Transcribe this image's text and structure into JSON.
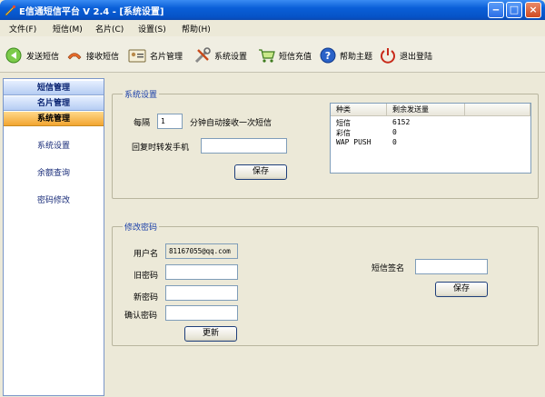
{
  "window": {
    "title": "E信通短信平台 V  2.4 - [系统设置]"
  },
  "menu": [
    "文件(F)",
    "短信(M)",
    "名片(C)",
    "设置(S)",
    "帮助(H)"
  ],
  "toolbar": [
    {
      "label": "发送短信",
      "icon": "send-icon"
    },
    {
      "label": "接收短信",
      "icon": "receive-icon"
    },
    {
      "label": "名片管理",
      "icon": "card-icon"
    },
    {
      "label": "系统设置",
      "icon": "settings-icon"
    },
    {
      "label": "短信充值",
      "icon": "cart-icon"
    },
    {
      "label": "帮助主题",
      "icon": "help-icon"
    },
    {
      "label": "退出登陆",
      "icon": "power-icon"
    }
  ],
  "sidebar": {
    "headers": [
      "短信管理",
      "名片管理",
      "系统管理"
    ],
    "links": [
      "系统设置",
      "余额查询",
      "密码修改"
    ]
  },
  "system_settings": {
    "title": "系统设置",
    "every_label": "每隔",
    "interval_value": "1",
    "interval_suffix": "分钟自动接收一次短信",
    "forward_label": "回复时转发手机",
    "forward_value": "",
    "save_label": "保存"
  },
  "balance": {
    "headers": [
      "种类",
      "剩余发送量"
    ],
    "rows": [
      {
        "type": "短信",
        "count": "6152"
      },
      {
        "type": "彩信",
        "count": "0"
      },
      {
        "type": "WAP PUSH",
        "count": "0"
      }
    ]
  },
  "password": {
    "title": "修改密码",
    "username_label": "用户名",
    "username_value": "81167055@qq.com",
    "old_label": "旧密码",
    "new_label": "新密码",
    "confirm_label": "确认密码",
    "update_label": "更新",
    "signature_label": "短信签名",
    "signature_value": "",
    "save_label": "保存"
  }
}
